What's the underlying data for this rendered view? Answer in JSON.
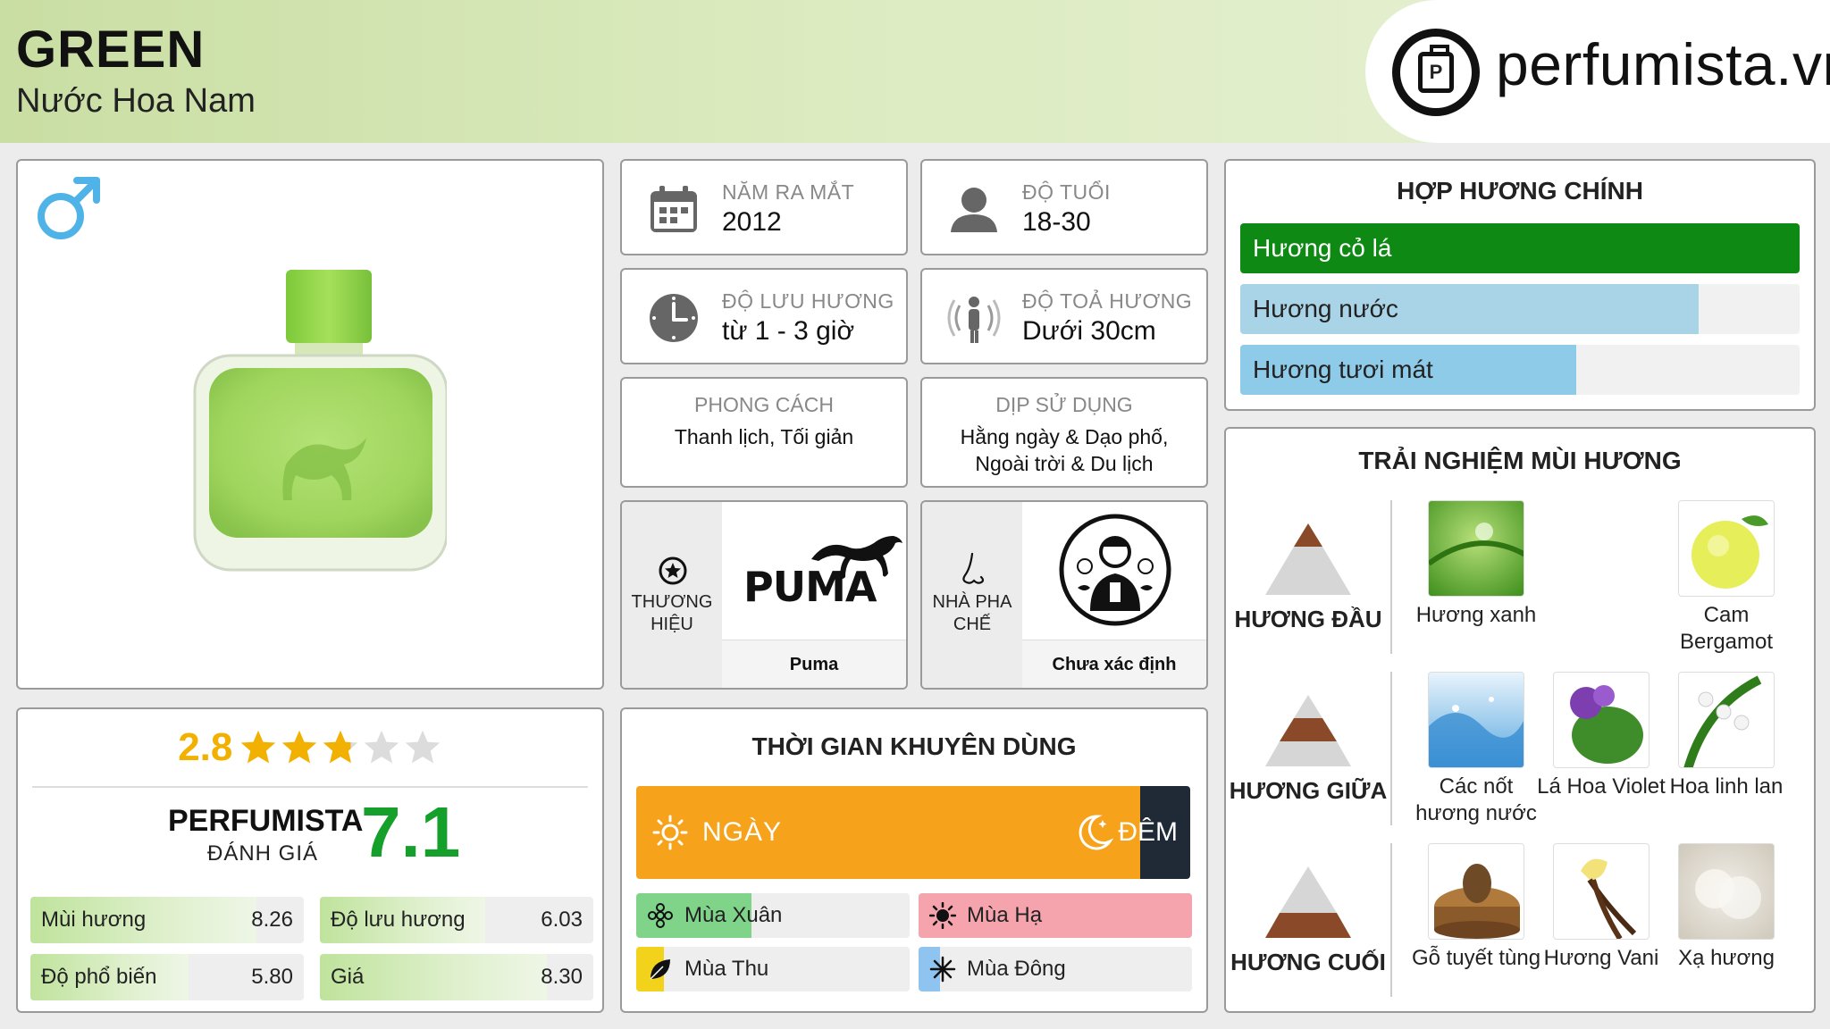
{
  "header": {
    "title": "GREEN",
    "subtitle": "Nước Hoa Nam",
    "logo_text": "perfumista.vn"
  },
  "info": {
    "launch_label": "NĂM RA MẮT",
    "launch_value": "2012",
    "age_label": "ĐỘ TUỔI",
    "age_value": "18-30",
    "longevity_label": "ĐỘ LƯU HƯƠNG",
    "longevity_value": "từ 1 - 3 giờ",
    "sillage_label": "ĐỘ TOẢ HƯƠNG",
    "sillage_value": "Dưới 30cm",
    "style_label": "PHONG CÁCH",
    "style_value": "Thanh lịch, Tối giản",
    "occasion_label": "DỊP SỬ DỤNG",
    "occasion_value": "Hằng ngày & Dạo phố, Ngoài trời & Du lịch"
  },
  "brand": {
    "label": "THƯƠNG HIỆU",
    "logo_word": "PUMA",
    "name": "Puma"
  },
  "perfumer": {
    "label": "NHÀ PHA CHẾ",
    "name": "Chưa xác định"
  },
  "accords": {
    "title": "HỢP HƯƠNG CHÍNH",
    "items": [
      {
        "label": "Hương cỏ lá",
        "level": 1.0,
        "color": "#0e8a14"
      },
      {
        "label": "Hương nước",
        "level": 0.82,
        "color": "#a9d3e6"
      },
      {
        "label": "Hương tươi mát",
        "level": 0.6,
        "color": "#8ecbe8"
      }
    ]
  },
  "notes": {
    "title": "TRẢI NGHIỆM MÙI HƯƠNG",
    "top_label": "HƯƠNG ĐẦU",
    "middle_label": "HƯƠNG GIỮA",
    "base_label": "HƯƠNG CUỐI",
    "top": [
      "Hương xanh",
      "Cam Bergamot"
    ],
    "middle": [
      "Các nốt hương nước",
      "Lá Hoa Violet",
      "Hoa linh lan"
    ],
    "base": [
      "Gỗ tuyết tùng",
      "Hương Vani",
      "Xạ hương"
    ]
  },
  "rating": {
    "stars_value": "2.8",
    "stars_level": 2.8,
    "pf_label": "PERFUMISTA",
    "pf_sub": "ĐÁNH GIÁ",
    "pf_score": "7.1",
    "metrics": [
      {
        "label": "Mùi hương",
        "value": "8.26",
        "level": 0.826
      },
      {
        "label": "Độ lưu hương",
        "value": "6.03",
        "level": 0.603
      },
      {
        "label": "Độ phổ biến",
        "value": "5.80",
        "level": 0.58
      },
      {
        "label": "Giá",
        "value": "8.30",
        "level": 0.83
      }
    ]
  },
  "usage": {
    "title": "THỜI GIAN KHUYÊN DÙNG",
    "day_label": "NGÀY",
    "night_label": "ĐÊM",
    "day_level": 0.91,
    "seasons": [
      {
        "label": "Mùa Xuân",
        "level": 0.42,
        "color": "#7fd48a"
      },
      {
        "label": "Mùa Hạ",
        "level": 1.0,
        "color": "#f5a3ad"
      },
      {
        "label": "Mùa Thu",
        "level": 0.1,
        "color": "#f2d21b"
      },
      {
        "label": "Mùa Đông",
        "level": 0.08,
        "color": "#8ec4ef"
      }
    ]
  }
}
